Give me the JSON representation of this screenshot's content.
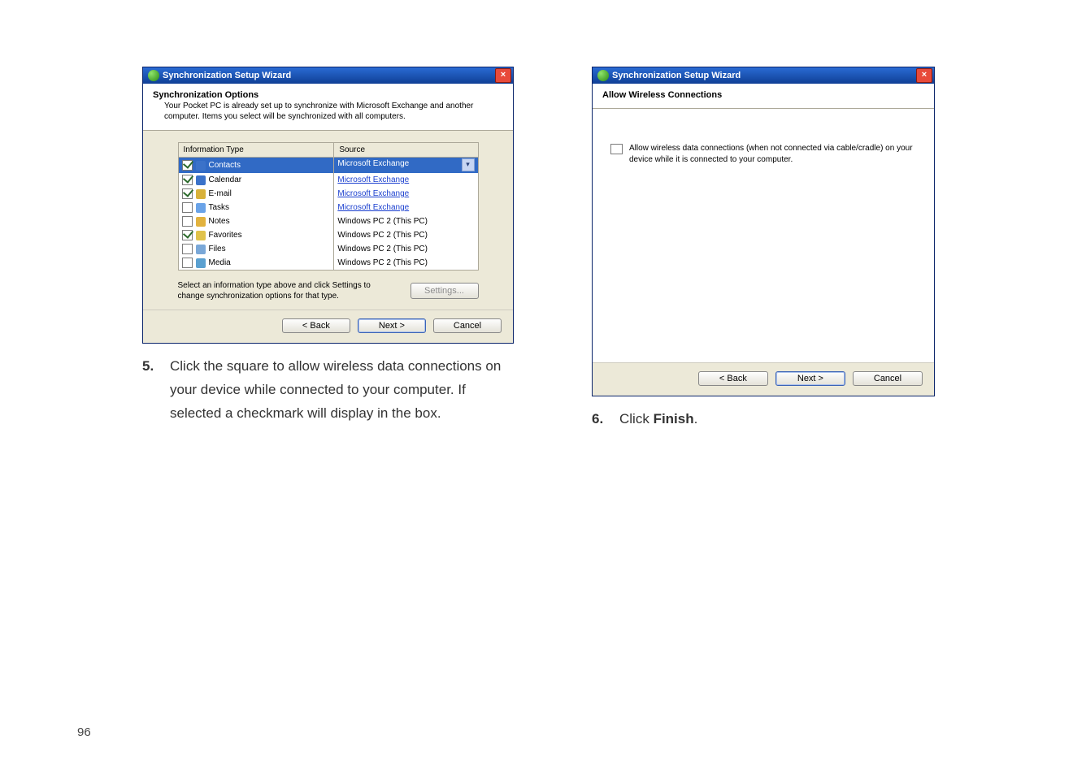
{
  "left_dialog": {
    "title": "Synchronization Setup Wizard",
    "close_glyph": "×",
    "header_title": "Synchronization Options",
    "header_sub": "Your Pocket PC is already set up to synchronize with Microsoft Exchange and another computer. Items you select will be synchronized with all computers.",
    "col1": "Information Type",
    "col2": "Source",
    "rows": [
      {
        "checked": true,
        "icon_color": "#3b72c9",
        "label": "Contacts",
        "source": "Microsoft Exchange",
        "selected": true,
        "dropdown": true,
        "link": false
      },
      {
        "checked": true,
        "icon_color": "#3b72c9",
        "label": "Calendar",
        "source": "Microsoft Exchange",
        "selected": false,
        "dropdown": false,
        "link": true
      },
      {
        "checked": true,
        "icon_color": "#d8b13a",
        "label": "E-mail",
        "source": "Microsoft Exchange",
        "selected": false,
        "dropdown": false,
        "link": true
      },
      {
        "checked": false,
        "icon_color": "#6aa3e8",
        "label": "Tasks",
        "source": "Microsoft Exchange",
        "selected": false,
        "dropdown": false,
        "link": true
      },
      {
        "checked": false,
        "icon_color": "#e2b23e",
        "label": "Notes",
        "source": "Windows PC 2 (This PC)",
        "selected": false,
        "dropdown": false,
        "link": false
      },
      {
        "checked": true,
        "icon_color": "#e0c24a",
        "label": "Favorites",
        "source": "Windows PC 2 (This PC)",
        "selected": false,
        "dropdown": false,
        "link": false
      },
      {
        "checked": false,
        "icon_color": "#7aa8d8",
        "label": "Files",
        "source": "Windows PC 2 (This PC)",
        "selected": false,
        "dropdown": false,
        "link": false
      },
      {
        "checked": false,
        "icon_color": "#5aa0d0",
        "label": "Media",
        "source": "Windows PC 2 (This PC)",
        "selected": false,
        "dropdown": false,
        "link": false
      }
    ],
    "below_text": "Select an information type above and click Settings to change synchronization options for that type.",
    "settings_btn": "Settings...",
    "back_btn": "< Back",
    "next_btn": "Next >",
    "cancel_btn": "Cancel"
  },
  "right_dialog": {
    "title": "Synchronization Setup Wizard",
    "close_glyph": "×",
    "header_title": "Allow Wireless Connections",
    "checkbox_text": "Allow wireless data connections (when not connected via cable/cradle) on your device while it is connected to your computer.",
    "back_btn": "< Back",
    "next_btn": "Next >",
    "cancel_btn": "Cancel"
  },
  "step5": {
    "num": "5.",
    "text": "Click the square to allow wireless data connections on your device while connected to your computer. If selected a checkmark will display in the box."
  },
  "step6": {
    "num": "6.",
    "prefix": "Click ",
    "bold": "Finish",
    "suffix": "."
  },
  "page_number": "96"
}
